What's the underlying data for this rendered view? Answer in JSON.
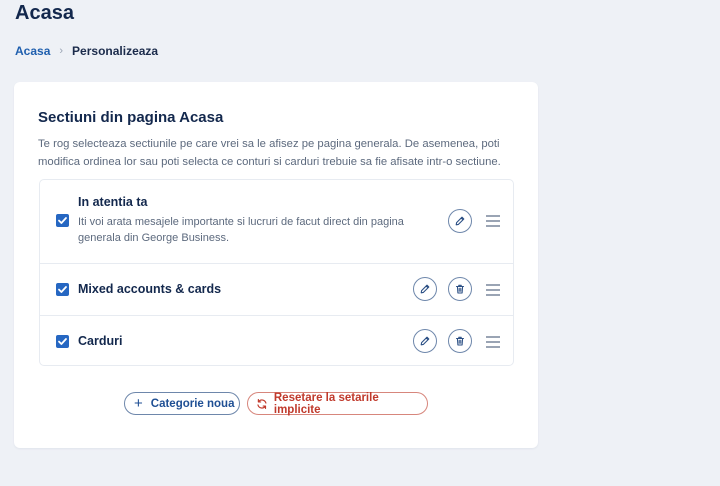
{
  "header": {
    "title": "Acasa"
  },
  "breadcrumb": {
    "home": "Acasa",
    "separator": "›",
    "current": "Personalizeaza"
  },
  "card": {
    "title": "Sectiuni din pagina Acasa",
    "description": "Te rog selecteaza sectiunile pe care vrei sa le afisez pe pagina generala. De asemenea, poti modifica ordinea lor sau poti selecta ce conturi si carduri trebuie sa fie afisate intr-o sectiune."
  },
  "sections": [
    {
      "title": "In atentia ta",
      "description": "Iti voi arata mesajele importante si lucruri de facut direct din pagina generala din George Business.",
      "checked": true,
      "actions": [
        "edit-icon",
        "drag-handle-icon"
      ]
    },
    {
      "title": "Mixed accounts & cards",
      "checked": true,
      "actions": [
        "edit-icon",
        "trash-icon",
        "drag-handle-icon"
      ]
    },
    {
      "title": "Carduri",
      "checked": true,
      "actions": [
        "edit-icon",
        "trash-icon",
        "drag-handle-icon"
      ]
    }
  ],
  "buttons": {
    "new_category": {
      "icon": "plus-icon",
      "label": "Categorie noua"
    },
    "reset": {
      "icon": "refresh-icon",
      "label": "Resetare la setarile implicite"
    }
  },
  "colors": {
    "background": "#eef1f6",
    "accent": "#2667c2",
    "title": "#13284d",
    "danger": "#c0392b"
  }
}
